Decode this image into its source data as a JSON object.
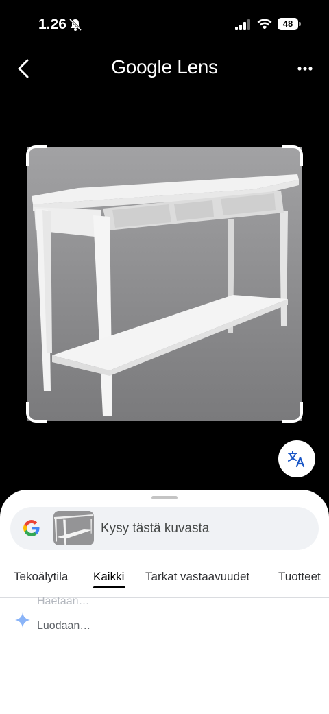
{
  "status_bar": {
    "time": "1.26",
    "battery": "48"
  },
  "header": {
    "title": "Google Lens"
  },
  "search": {
    "placeholder": "Kysy tästä kuvasta"
  },
  "tabs": [
    {
      "label": "Tekoälytila"
    },
    {
      "label": "Kaikki",
      "selected": true
    },
    {
      "label": "Tarkat vastaavuudet"
    },
    {
      "label": "Tuotteet"
    }
  ],
  "results": {
    "loading_primary": "Haetaan…",
    "loading_secondary": "Luodaan…"
  },
  "colors": {
    "accent": "#000000",
    "sheet_bg": "#ffffff",
    "search_bg": "#f0f2f5",
    "sparkle": "#8ab4f8"
  },
  "icons": [
    "bell-muted-icon",
    "signal-icon",
    "wifi-icon",
    "battery-icon",
    "back-icon",
    "more-icon",
    "translate-icon",
    "google-icon",
    "sparkle-icon"
  ]
}
